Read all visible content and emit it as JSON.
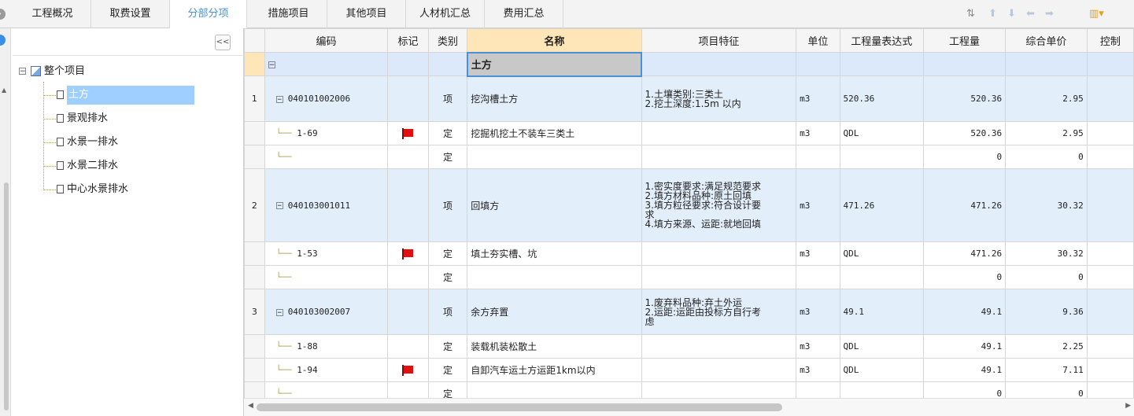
{
  "tabs": [
    "工程概况",
    "取费设置",
    "分部分项",
    "措施项目",
    "其他项目",
    "人材机汇总",
    "费用汇总"
  ],
  "active_tab": "分部分项",
  "left_panel": {
    "collapse_label": "<<",
    "root": "整个项目",
    "nodes": [
      "土方",
      "景观排水",
      "水景一排水",
      "水景二排水",
      "中心水景排水"
    ],
    "selected": "土方"
  },
  "grid": {
    "columns": [
      "编码",
      "标记",
      "类别",
      "名称",
      "项目特征",
      "单位",
      "工程量表达式",
      "工程量",
      "综合单价",
      "控制"
    ],
    "section": {
      "name": "土方"
    },
    "rows": [
      {
        "type": "item",
        "rowno": "1",
        "code": "040101002006",
        "category": "项",
        "name": "挖沟槽土方",
        "features": [
          "1.土壤类别:三类土",
          "2.挖土深度:1.5m 以内"
        ],
        "unit": "m3",
        "expr": "520.36",
        "qty": "520.36",
        "price": "2.95",
        "flag": false
      },
      {
        "type": "sub",
        "rowno": "",
        "code": "1-69",
        "category": "定",
        "name": "挖掘机挖土不装车三类土",
        "features": [],
        "unit": "m3",
        "expr": "QDL",
        "qty": "520.36",
        "price": "2.95",
        "flag": true
      },
      {
        "type": "sub",
        "rowno": "",
        "code": "",
        "category": "定",
        "name": "",
        "features": [],
        "unit": "",
        "expr": "",
        "qty": "0",
        "price": "0",
        "flag": false
      },
      {
        "type": "item",
        "rowno": "2",
        "code": "040103001011",
        "category": "项",
        "name": "回填方",
        "features": [
          "1.密实度要求:满足规范要求",
          "2.填方材料品种:原土回填",
          "3.填方粒径要求:符合设计要",
          "求",
          "4.填方来源、运距:就地回填"
        ],
        "unit": "m3",
        "expr": "471.26",
        "qty": "471.26",
        "price": "30.32",
        "flag": false
      },
      {
        "type": "sub",
        "rowno": "",
        "code": "1-53",
        "category": "定",
        "name": "填土夯实槽、坑",
        "features": [],
        "unit": "m3",
        "expr": "QDL",
        "qty": "471.26",
        "price": "30.32",
        "flag": true
      },
      {
        "type": "sub",
        "rowno": "",
        "code": "",
        "category": "定",
        "name": "",
        "features": [],
        "unit": "",
        "expr": "",
        "qty": "0",
        "price": "0",
        "flag": false
      },
      {
        "type": "item",
        "rowno": "3",
        "code": "040103002007",
        "category": "项",
        "name": "余方弃置",
        "features": [
          "1.废弃料品种:弃土外运",
          "2.运距:运距由投标方自行考",
          "虑"
        ],
        "unit": "m3",
        "expr": "49.1",
        "qty": "49.1",
        "price": "9.36",
        "flag": false
      },
      {
        "type": "sub",
        "rowno": "",
        "code": "1-88",
        "category": "定",
        "name": "装载机装松散土",
        "features": [],
        "unit": "m3",
        "expr": "QDL",
        "qty": "49.1",
        "price": "2.25",
        "flag": false
      },
      {
        "type": "sub",
        "rowno": "",
        "code": "1-94",
        "category": "定",
        "name": "自卸汽车运土方运距1km以内",
        "features": [],
        "unit": "m3",
        "expr": "QDL",
        "qty": "49.1",
        "price": "7.11",
        "flag": true
      },
      {
        "type": "sub",
        "rowno": "",
        "code": "",
        "category": "定",
        "name": "",
        "features": [],
        "unit": "",
        "expr": "",
        "qty": "0",
        "price": "0",
        "flag": false
      }
    ]
  },
  "colors": {
    "accent": "#4a90d9",
    "selected_node": "#9ecfff",
    "item_row": "#e3eefb",
    "name_header": "#ffe6b8",
    "flag": "#e01010"
  }
}
